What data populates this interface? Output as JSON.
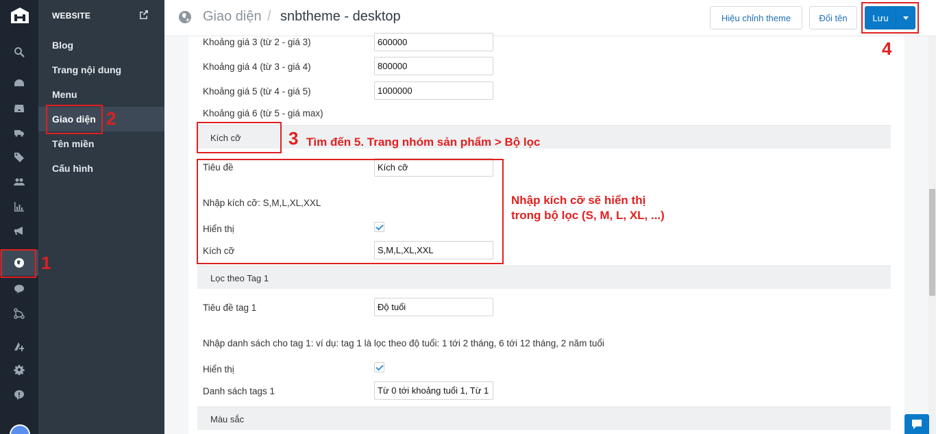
{
  "sidebar": {
    "header": "WEBSITE",
    "items": [
      {
        "label": "Blog"
      },
      {
        "label": "Trang nội dung"
      },
      {
        "label": "Menu"
      },
      {
        "label": "Giao diện"
      },
      {
        "label": "Tên miền"
      },
      {
        "label": "Cấu hình"
      }
    ]
  },
  "header": {
    "crumb_root": "Giao diện",
    "separator": "/",
    "crumb_current": "snbtheme - desktop",
    "edit_theme_label": "Hiệu chỉnh theme",
    "rename_label": "Đổi tên",
    "save_label": "Lưu"
  },
  "form": {
    "price3": {
      "label": "Khoảng giá 3 (từ 2 - giá 3)",
      "value": "600000"
    },
    "price4": {
      "label": "Khoảng giá 4 (từ 3 - giá 4)",
      "value": "800000"
    },
    "price5": {
      "label": "Khoảng giá 5 (từ 4 - giá 5)",
      "value": "1000000"
    },
    "price6": {
      "label": "Khoảng giá 6 (từ 5 - giá max)"
    },
    "size_section": "Kích cỡ",
    "size_title": {
      "label": "Tiêu đề",
      "value": "Kích cỡ"
    },
    "size_hint": "Nhập kích cỡ: S,M,L,XL,XXL",
    "size_show": {
      "label": "Hiển thị",
      "checked": true
    },
    "size_values": {
      "label": "Kích cỡ",
      "value": "S,M,L,XL,XXL"
    },
    "tag_section": "Lọc theo Tag 1",
    "tag_title": {
      "label": "Tiêu đề tag 1",
      "value": "Độ tuổi"
    },
    "tag_hint": "Nhập danh sách cho tag 1: ví dụ: tag 1 là lọc theo độ tuổi: 1 tới 2 tháng, 6 tới 12 tháng, 2 năm tuổi",
    "tag_show": {
      "label": "Hiển thị",
      "checked": true
    },
    "tag_list": {
      "label": "Danh sách tags 1",
      "value": "Từ 0 tới khoảng tuổi 1, Từ 1"
    },
    "color_section": "Màu sắc"
  },
  "annotations": {
    "n1": "1",
    "n2": "2",
    "n3": "3",
    "n4": "4",
    "step3_text": "Tìm đến 5. Trang nhóm sản phẩm > Bộ lọc",
    "note_line1": "Nhập kích cỡ sẽ hiển thị",
    "note_line2": "trong bộ lọc (S, M, L, XL, ...)"
  },
  "colors": {
    "rail_bg": "#1c2530",
    "sidebar_bg": "#2e3944",
    "primary": "#0a7ac8",
    "annotation": "#e02020"
  },
  "icons": {
    "rail": [
      "search-icon",
      "dashboard-icon",
      "inbox-icon",
      "truck-icon",
      "tag-icon",
      "users-icon",
      "chart-icon",
      "megaphone-icon",
      "globe-icon",
      "chat-icon",
      "flow-icon",
      "apps-icon",
      "gear-icon",
      "help-icon"
    ]
  }
}
